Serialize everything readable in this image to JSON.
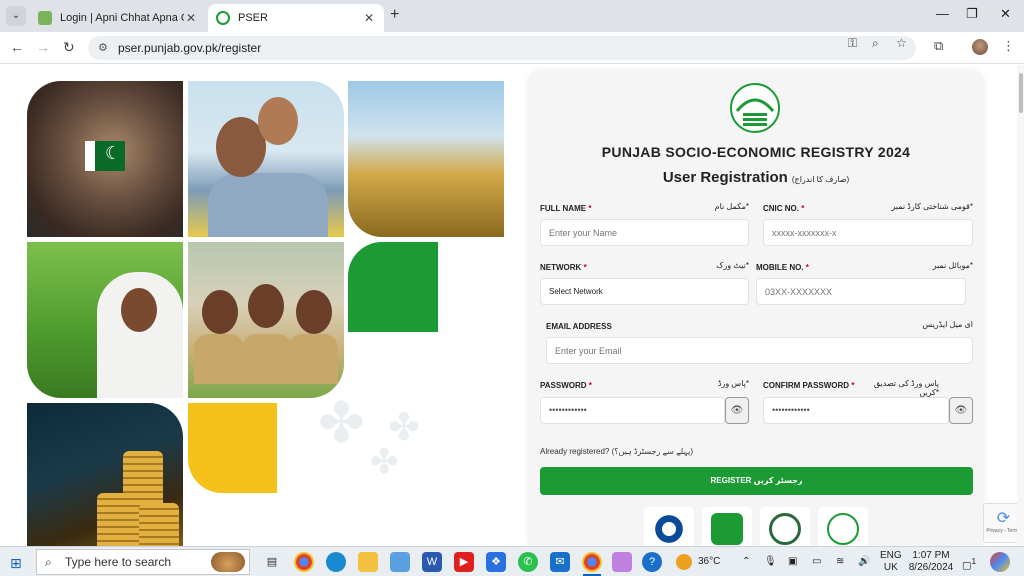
{
  "browser": {
    "tabs": [
      {
        "title": "Login | Apni Chhat Apna Ghar",
        "favicon": "house-favicon",
        "active": false
      },
      {
        "title": "PSER",
        "favicon": "punjab-favicon",
        "active": true
      }
    ],
    "url": "pser.punjab.gov.pk/register"
  },
  "form": {
    "title": "PUNJAB SOCIO-ECONOMIC REGISTRY 2024",
    "subtitle": "User Registration",
    "subtitle_urdu": "(صارف کا اندراج)",
    "full_name": {
      "label": "FULL NAME",
      "urdu": "مکمل نام*",
      "placeholder": "Enter your Name"
    },
    "cnic": {
      "label": "CNIC NO.",
      "urdu": "قومی شناختی کارڈ نمبر*",
      "placeholder": "xxxxx-xxxxxxx-x"
    },
    "network": {
      "label": "NETWORK",
      "urdu": "نیٹ ورک*",
      "selected": "Select Network"
    },
    "mobile": {
      "label": "MOBILE NO.",
      "urdu": "موبائل نمبر*",
      "placeholder": "03XX-XXXXXXX"
    },
    "email": {
      "label": "EMAIL ADDRESS",
      "urdu": "ای میل ایڈریس",
      "placeholder": "Enter your Email"
    },
    "password": {
      "label": "PASSWORD",
      "urdu": "پاس ورڈ*",
      "value": "••••••••••••"
    },
    "confirm_password": {
      "label": "CONFIRM PASSWORD",
      "urdu": "پاس ورڈ کی تصدیق کریں*",
      "value": "••••••••••••"
    },
    "required_mark": "*",
    "already_registered": "Already registered? (پہلے سے رجسٹرڈ ہیں؟)",
    "register_button": "REGISTER رجسٹر کریں"
  },
  "recaptcha": {
    "text": "Privacy - Terms"
  },
  "taskbar": {
    "search_placeholder": "Type here to search",
    "weather": "36°C",
    "lang_top": "ENG",
    "lang_bottom": "UK",
    "time": "1:07 PM",
    "date": "8/26/2024",
    "notification_count": "1"
  },
  "colors": {
    "brand_green": "#1c9a34",
    "accent_yellow": "#f5c21b",
    "required_red": "#c0001a"
  }
}
